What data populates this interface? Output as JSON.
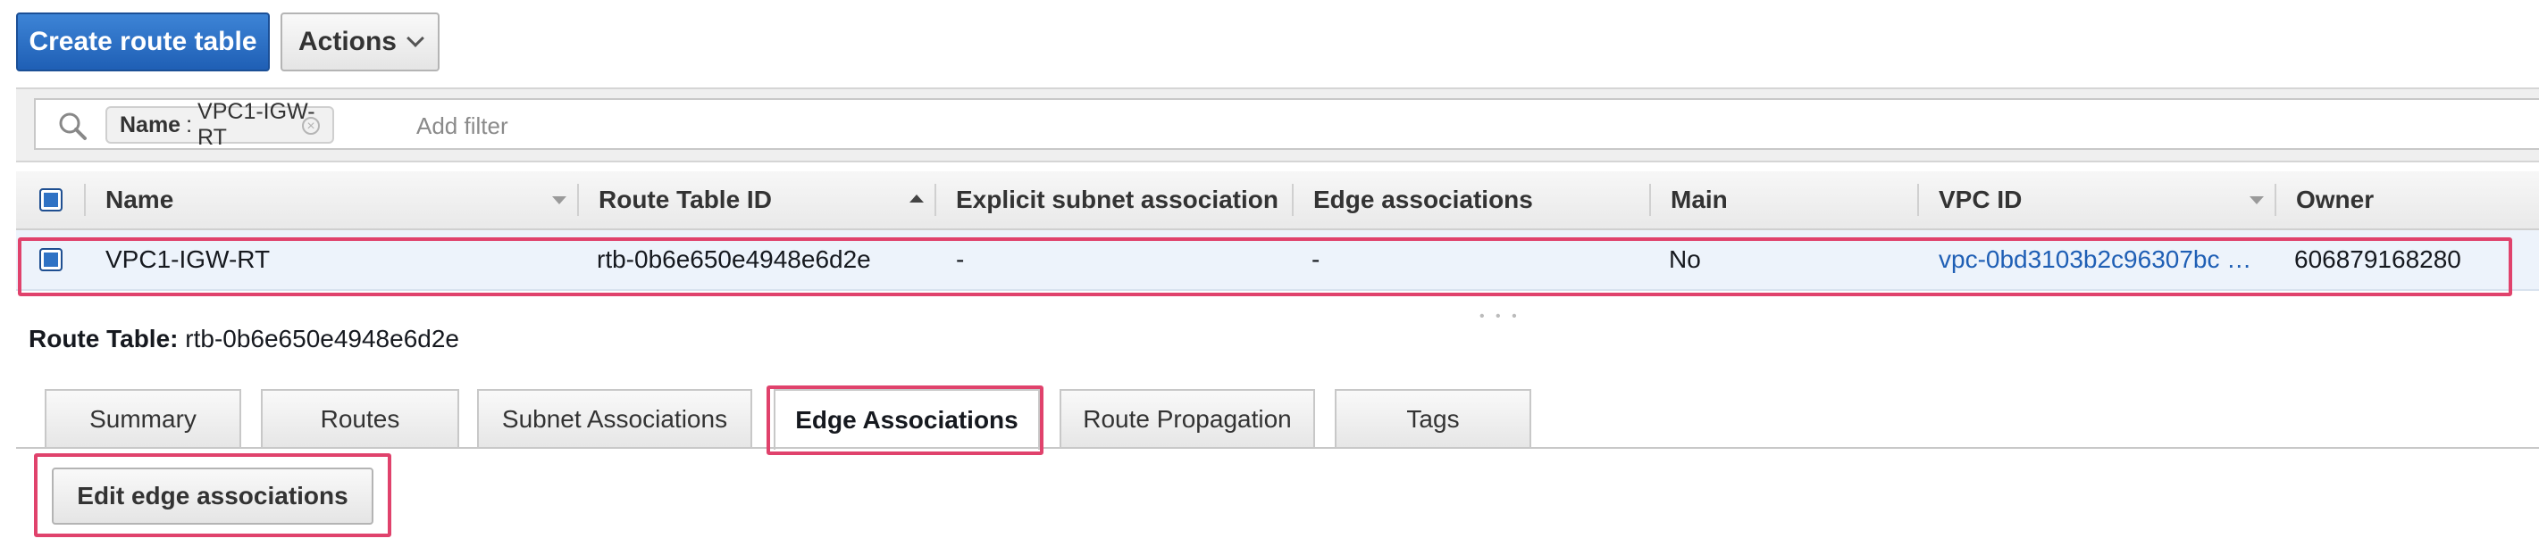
{
  "toolbar": {
    "create_label": "Create route table",
    "actions_label": "Actions"
  },
  "filter": {
    "token_key": "Name",
    "token_separator": ":",
    "token_value": "VPC1-IGW-RT",
    "placeholder": "Add filter"
  },
  "table": {
    "columns": [
      "Name",
      "Route Table ID",
      "Explicit subnet association",
      "Edge associations",
      "Main",
      "VPC ID",
      "Owner"
    ],
    "rows": [
      {
        "name": "VPC1-IGW-RT",
        "route_table_id": "rtb-0b6e650e4948e6d2e",
        "explicit_subnet": "-",
        "edge": "-",
        "main": "No",
        "vpc_id": "vpc-0bd3103b2c96307bc …",
        "owner": "606879168280"
      }
    ]
  },
  "details": {
    "label": "Route Table:",
    "value": "rtb-0b6e650e4948e6d2e"
  },
  "tabs": [
    {
      "label": "Summary"
    },
    {
      "label": "Routes"
    },
    {
      "label": "Subnet Associations"
    },
    {
      "label": "Edge Associations",
      "active": true
    },
    {
      "label": "Route Propagation"
    },
    {
      "label": "Tags"
    }
  ],
  "edge_panel": {
    "edit_label": "Edit edge associations"
  },
  "colors": {
    "primary": "#1f5fb5",
    "highlight": "#e0426c",
    "link": "#1f5fb5"
  }
}
